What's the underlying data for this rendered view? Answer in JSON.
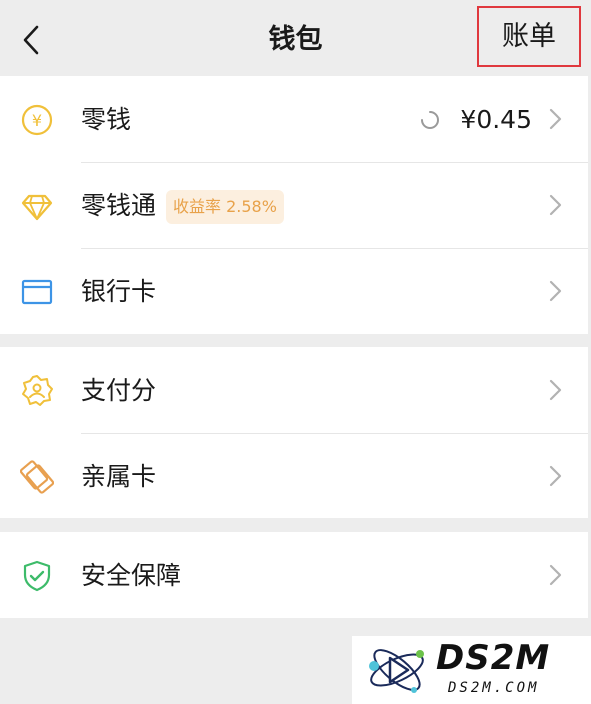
{
  "header": {
    "title": "钱包",
    "bill_label": "账单",
    "back_icon": "chevron-left-icon"
  },
  "groups": [
    {
      "items": [
        {
          "label": "零钱",
          "icon": "yuan-coin-icon",
          "value": "¥0.45",
          "loading": true
        },
        {
          "label": "零钱通",
          "icon": "diamond-icon",
          "badge": "收益率 2.58%"
        },
        {
          "label": "银行卡",
          "icon": "bank-card-icon"
        }
      ]
    },
    {
      "items": [
        {
          "label": "支付分",
          "icon": "credit-score-icon"
        },
        {
          "label": "亲属卡",
          "icon": "family-card-icon"
        }
      ]
    },
    {
      "items": [
        {
          "label": "安全保障",
          "icon": "shield-check-icon"
        }
      ]
    }
  ],
  "watermark": {
    "text": "DS2M",
    "sub": "DS2M.COM"
  },
  "colors": {
    "background": "#ededed",
    "highlight_border": "#e0383e",
    "coin": "#f0c03a",
    "badge_bg": "#fcefdf",
    "badge_text": "#e8a24a",
    "card_blue": "#3d94e6",
    "shield_green": "#3dbb6a",
    "family_orange": "#e8a050"
  }
}
